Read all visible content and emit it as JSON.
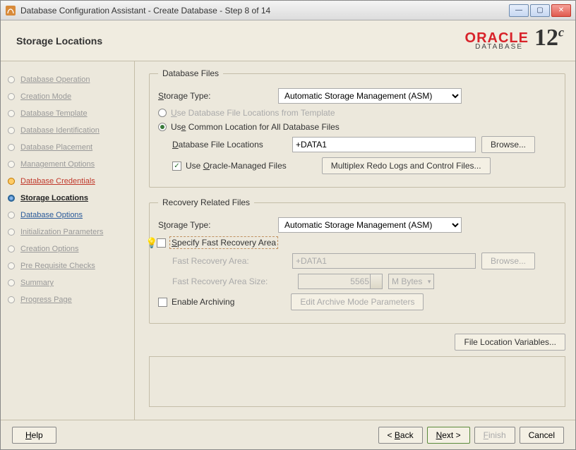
{
  "titlebar": {
    "text": "Database Configuration Assistant - Create Database - Step 8 of 14"
  },
  "header": {
    "title": "Storage Locations",
    "brand": "ORACLE",
    "brand_sub": "DATABASE",
    "version": "12",
    "version_suffix": "c"
  },
  "sidebar": {
    "steps": [
      {
        "label": "Database Operation",
        "state": "dim"
      },
      {
        "label": "Creation Mode",
        "state": "dim"
      },
      {
        "label": "Database Template",
        "state": "dim"
      },
      {
        "label": "Database Identification",
        "state": "dim"
      },
      {
        "label": "Database Placement",
        "state": "dim"
      },
      {
        "label": "Management Options",
        "state": "dim"
      },
      {
        "label": "Database Credentials",
        "state": "warn"
      },
      {
        "label": "Storage Locations",
        "state": "current"
      },
      {
        "label": "Database Options",
        "state": "next"
      },
      {
        "label": "Initialization Parameters",
        "state": "dim"
      },
      {
        "label": "Creation Options",
        "state": "dim"
      },
      {
        "label": "Pre Requisite Checks",
        "state": "dim"
      },
      {
        "label": "Summary",
        "state": "dim"
      },
      {
        "label": "Progress Page",
        "state": "dim"
      }
    ]
  },
  "dbfiles": {
    "legend": "Database Files",
    "storage_type_label": "Storage Type:",
    "storage_type_value": "Automatic Storage Management (ASM)",
    "opt_template": "Use Database File Locations from Template",
    "opt_common": "Use Common Location for All Database Files",
    "loc_label": "Database File Locations",
    "loc_value": "+DATA1",
    "browse": "Browse...",
    "omf_label": "Use Oracle-Managed Files",
    "multiplex_btn": "Multiplex Redo Logs and Control Files..."
  },
  "recovery": {
    "legend": "Recovery Related Files",
    "storage_type_label": "Storage Type:",
    "storage_type_value": "Automatic Storage Management (ASM)",
    "specify_label": "Specify Fast Recovery Area",
    "fra_label": "Fast Recovery Area:",
    "fra_value": "+DATA1",
    "browse": "Browse...",
    "fra_size_label": "Fast Recovery Area Size:",
    "fra_size_value": "5565",
    "unit": "M Bytes",
    "archive_label": "Enable Archiving",
    "archive_btn": "Edit Archive Mode Parameters"
  },
  "file_loc_vars": "File Location Variables...",
  "footer": {
    "help": "Help",
    "back": "< Back",
    "next": "Next >",
    "finish": "Finish",
    "cancel": "Cancel"
  }
}
